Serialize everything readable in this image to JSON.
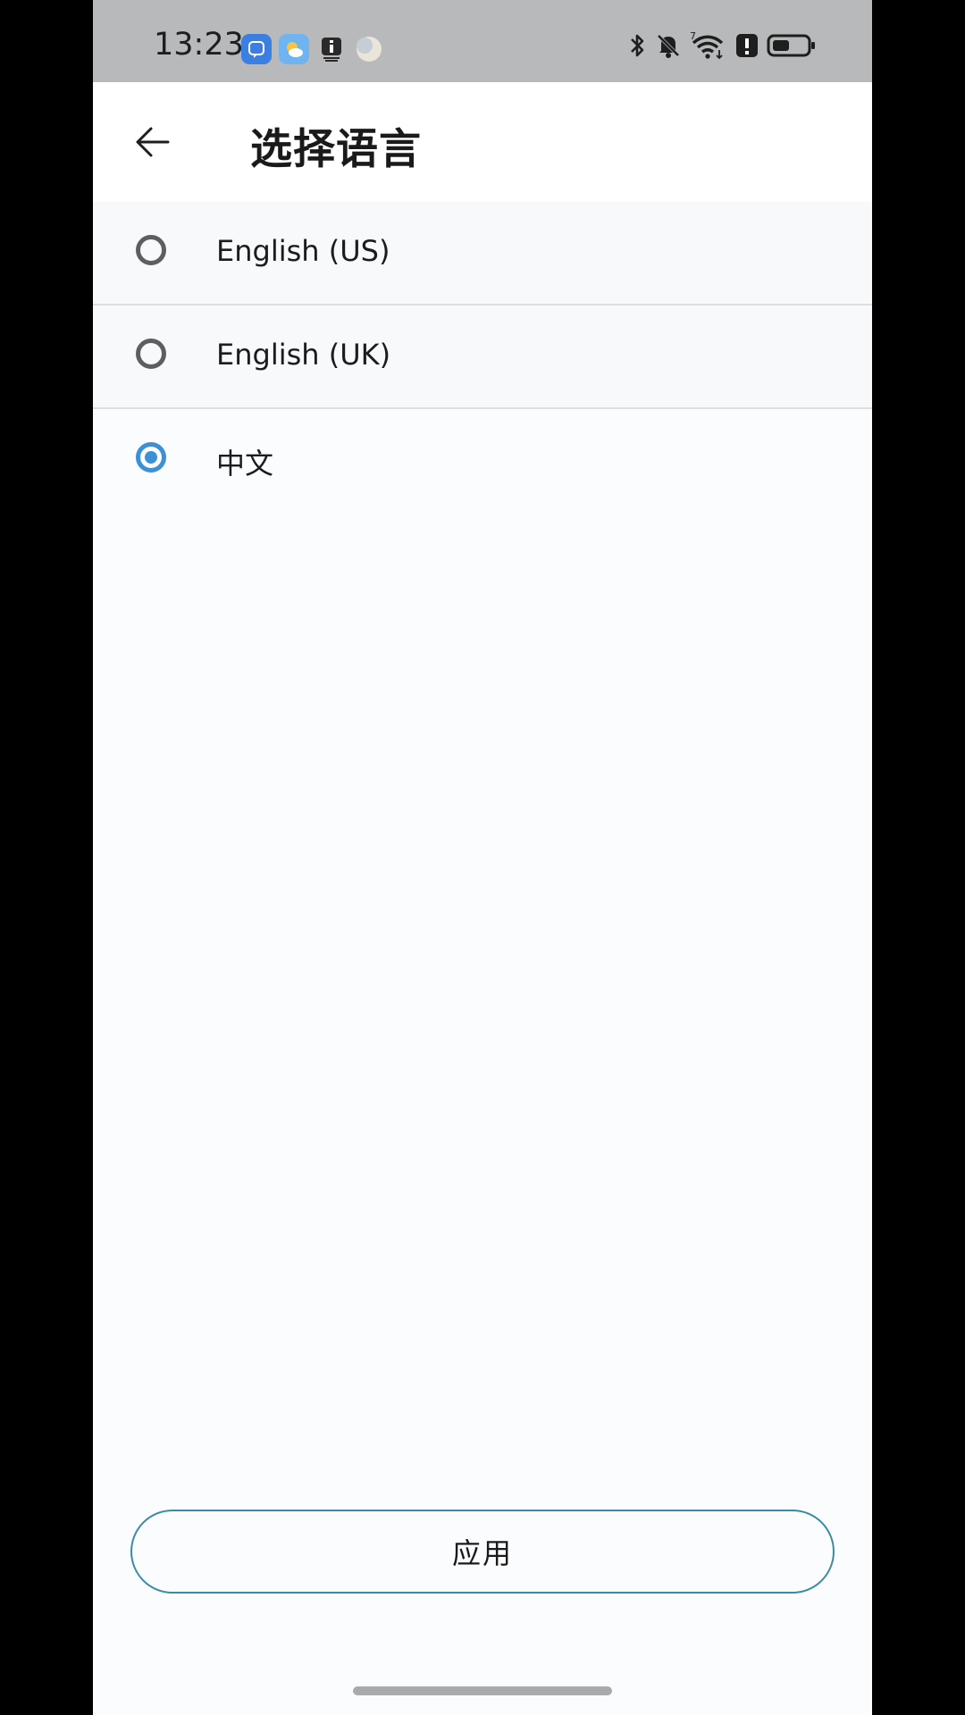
{
  "status_bar": {
    "time": "13:23",
    "notification_icons": [
      "message-app-icon",
      "weather-app-icon",
      "info-app-icon",
      "moon-app-icon"
    ],
    "system_icons": [
      "bluetooth-icon",
      "mute-icon",
      "wifi-icon",
      "alert-icon",
      "battery-icon"
    ],
    "wifi_superscript": "7"
  },
  "header": {
    "title": "选择语言"
  },
  "languages": [
    {
      "label": "English (US)",
      "selected": false
    },
    {
      "label": "English (UK)",
      "selected": false
    },
    {
      "label": "中文",
      "selected": true
    }
  ],
  "footer": {
    "apply_label": "应用"
  },
  "colors": {
    "accent": "#3c90d6",
    "button_border": "#3a8aa8",
    "status_bar": "#b8b9bb",
    "background": "#fbfcfd"
  }
}
